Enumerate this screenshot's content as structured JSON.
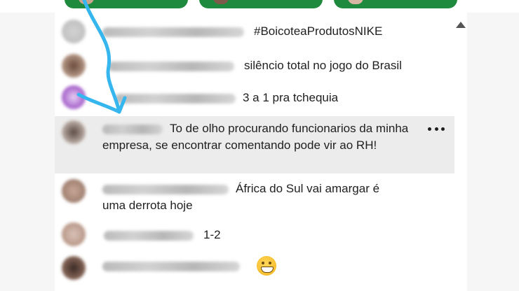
{
  "colors": {
    "chip_green": "#1e8a3e",
    "highlight_row": "#ececec",
    "annotation_arrow": "#35b6ef"
  },
  "top_chips": [
    {
      "name": "reaction-chip-1",
      "icon": "avatar-icon"
    },
    {
      "name": "reaction-chip-2",
      "icon": "avatar-icon"
    },
    {
      "name": "reaction-chip-3",
      "icon": "avatar-icon"
    }
  ],
  "comments": [
    {
      "text": "#BoicoteaProdutosNIKE"
    },
    {
      "text": "silêncio total no jogo do Brasil"
    },
    {
      "text": "3 a 1 pra tchequia"
    },
    {
      "text": "To de olho procurando funcionarios da minha empresa, se encontrar comentando pode vir ao RH!",
      "highlighted": true,
      "more_icon": "more-horizontal-icon"
    },
    {
      "text": "África do Sul vai amargar é uma derrota hoje"
    },
    {
      "text": "1-2"
    },
    {
      "text": "",
      "emoji": "grinning-face-icon"
    }
  ],
  "controls": {
    "scroll_icon": "triangle-up-icon"
  }
}
